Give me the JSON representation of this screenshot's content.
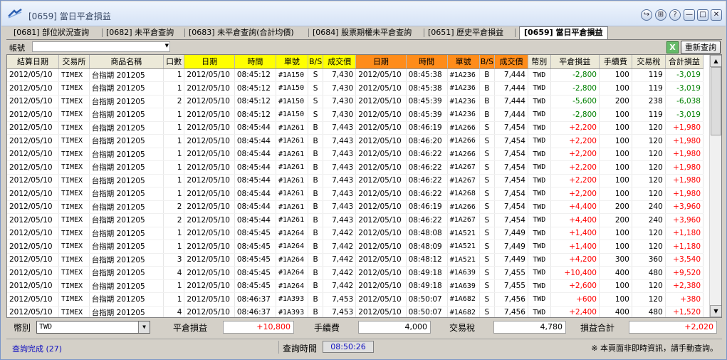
{
  "window": {
    "title": "[0659] 當日平倉損益",
    "buttons": [
      "↪",
      "⊞",
      "?",
      "—",
      "□",
      "✕"
    ]
  },
  "tabs": [
    {
      "label": "[0681] 部位狀況查詢",
      "active": false
    },
    {
      "label": "[0682] 未平倉查詢",
      "active": false
    },
    {
      "label": "[0683] 未平倉查詢(合計均價)",
      "active": false
    },
    {
      "label": "[0684] 股票期權未平倉查詢",
      "active": false
    },
    {
      "label": "[0651] 歷史平倉損益",
      "active": false
    },
    {
      "label": "[0659] 當日平倉損益",
      "active": true
    }
  ],
  "account": {
    "label": "帳號",
    "value": ""
  },
  "toolbar": {
    "excel_label": "X",
    "requery_label": "重新查詢"
  },
  "colors": {
    "yellow_header": "#ffff00",
    "orange_header": "#ff8c1a",
    "positive": "#ff0000",
    "negative": "#008000",
    "status_blue": "#1010c0"
  },
  "columns": [
    "結算日期",
    "交易所",
    "商品名稱",
    "口數",
    "日期",
    "時間",
    "單號",
    "B/S",
    "成交價",
    "日期",
    "時間",
    "單號",
    "B/S",
    "成交價",
    "幣別",
    "平倉損益",
    "手續費",
    "交易稅",
    "合計損益"
  ],
  "rows": [
    [
      "2012/05/10",
      "TIMEX",
      "台指期 201205",
      "1",
      "2012/05/10",
      "08:45:12",
      "#1A150",
      "S",
      "7,430",
      "2012/05/10",
      "08:45:38",
      "#1A236",
      "B",
      "7,444",
      "TWD",
      "-2,800",
      "100",
      "119",
      "-3,019"
    ],
    [
      "2012/05/10",
      "TIMEX",
      "台指期 201205",
      "1",
      "2012/05/10",
      "08:45:12",
      "#1A150",
      "S",
      "7,430",
      "2012/05/10",
      "08:45:38",
      "#1A236",
      "B",
      "7,444",
      "TWD",
      "-2,800",
      "100",
      "119",
      "-3,019"
    ],
    [
      "2012/05/10",
      "TIMEX",
      "台指期 201205",
      "2",
      "2012/05/10",
      "08:45:12",
      "#1A150",
      "S",
      "7,430",
      "2012/05/10",
      "08:45:39",
      "#1A236",
      "B",
      "7,444",
      "TWD",
      "-5,600",
      "200",
      "238",
      "-6,038"
    ],
    [
      "2012/05/10",
      "TIMEX",
      "台指期 201205",
      "1",
      "2012/05/10",
      "08:45:12",
      "#1A150",
      "S",
      "7,430",
      "2012/05/10",
      "08:45:39",
      "#1A236",
      "B",
      "7,444",
      "TWD",
      "-2,800",
      "100",
      "119",
      "-3,019"
    ],
    [
      "2012/05/10",
      "TIMEX",
      "台指期 201205",
      "1",
      "2012/05/10",
      "08:45:44",
      "#1A261",
      "B",
      "7,443",
      "2012/05/10",
      "08:46:19",
      "#1A266",
      "S",
      "7,454",
      "TWD",
      "+2,200",
      "100",
      "120",
      "+1,980"
    ],
    [
      "2012/05/10",
      "TIMEX",
      "台指期 201205",
      "1",
      "2012/05/10",
      "08:45:44",
      "#1A261",
      "B",
      "7,443",
      "2012/05/10",
      "08:46:20",
      "#1A266",
      "S",
      "7,454",
      "TWD",
      "+2,200",
      "100",
      "120",
      "+1,980"
    ],
    [
      "2012/05/10",
      "TIMEX",
      "台指期 201205",
      "1",
      "2012/05/10",
      "08:45:44",
      "#1A261",
      "B",
      "7,443",
      "2012/05/10",
      "08:46:22",
      "#1A266",
      "S",
      "7,454",
      "TWD",
      "+2,200",
      "100",
      "120",
      "+1,980"
    ],
    [
      "2012/05/10",
      "TIMEX",
      "台指期 201205",
      "1",
      "2012/05/10",
      "08:45:44",
      "#1A261",
      "B",
      "7,443",
      "2012/05/10",
      "08:46:22",
      "#1A267",
      "S",
      "7,454",
      "TWD",
      "+2,200",
      "100",
      "120",
      "+1,980"
    ],
    [
      "2012/05/10",
      "TIMEX",
      "台指期 201205",
      "1",
      "2012/05/10",
      "08:45:44",
      "#1A261",
      "B",
      "7,443",
      "2012/05/10",
      "08:46:22",
      "#1A267",
      "S",
      "7,454",
      "TWD",
      "+2,200",
      "100",
      "120",
      "+1,980"
    ],
    [
      "2012/05/10",
      "TIMEX",
      "台指期 201205",
      "1",
      "2012/05/10",
      "08:45:44",
      "#1A261",
      "B",
      "7,443",
      "2012/05/10",
      "08:46:22",
      "#1A268",
      "S",
      "7,454",
      "TWD",
      "+2,200",
      "100",
      "120",
      "+1,980"
    ],
    [
      "2012/05/10",
      "TIMEX",
      "台指期 201205",
      "2",
      "2012/05/10",
      "08:45:44",
      "#1A261",
      "B",
      "7,443",
      "2012/05/10",
      "08:46:19",
      "#1A266",
      "S",
      "7,454",
      "TWD",
      "+4,400",
      "200",
      "240",
      "+3,960"
    ],
    [
      "2012/05/10",
      "TIMEX",
      "台指期 201205",
      "2",
      "2012/05/10",
      "08:45:44",
      "#1A261",
      "B",
      "7,443",
      "2012/05/10",
      "08:46:22",
      "#1A267",
      "S",
      "7,454",
      "TWD",
      "+4,400",
      "200",
      "240",
      "+3,960"
    ],
    [
      "2012/05/10",
      "TIMEX",
      "台指期 201205",
      "1",
      "2012/05/10",
      "08:45:45",
      "#1A264",
      "B",
      "7,442",
      "2012/05/10",
      "08:48:08",
      "#1A521",
      "S",
      "7,449",
      "TWD",
      "+1,400",
      "100",
      "120",
      "+1,180"
    ],
    [
      "2012/05/10",
      "TIMEX",
      "台指期 201205",
      "1",
      "2012/05/10",
      "08:45:45",
      "#1A264",
      "B",
      "7,442",
      "2012/05/10",
      "08:48:09",
      "#1A521",
      "S",
      "7,449",
      "TWD",
      "+1,400",
      "100",
      "120",
      "+1,180"
    ],
    [
      "2012/05/10",
      "TIMEX",
      "台指期 201205",
      "3",
      "2012/05/10",
      "08:45:45",
      "#1A264",
      "B",
      "7,442",
      "2012/05/10",
      "08:48:12",
      "#1A521",
      "S",
      "7,449",
      "TWD",
      "+4,200",
      "300",
      "360",
      "+3,540"
    ],
    [
      "2012/05/10",
      "TIMEX",
      "台指期 201205",
      "4",
      "2012/05/10",
      "08:45:45",
      "#1A264",
      "B",
      "7,442",
      "2012/05/10",
      "08:49:18",
      "#1A639",
      "S",
      "7,455",
      "TWD",
      "+10,400",
      "400",
      "480",
      "+9,520"
    ],
    [
      "2012/05/10",
      "TIMEX",
      "台指期 201205",
      "1",
      "2012/05/10",
      "08:45:45",
      "#1A264",
      "B",
      "7,442",
      "2012/05/10",
      "08:49:18",
      "#1A639",
      "S",
      "7,455",
      "TWD",
      "+2,600",
      "100",
      "120",
      "+2,380"
    ],
    [
      "2012/05/10",
      "TIMEX",
      "台指期 201205",
      "1",
      "2012/05/10",
      "08:46:37",
      "#1A393",
      "B",
      "7,453",
      "2012/05/10",
      "08:50:07",
      "#1A682",
      "S",
      "7,456",
      "TWD",
      "+600",
      "100",
      "120",
      "+380"
    ],
    [
      "2012/05/10",
      "TIMEX",
      "台指期 201205",
      "4",
      "2012/05/10",
      "08:46:37",
      "#1A393",
      "B",
      "7,453",
      "2012/05/10",
      "08:50:07",
      "#1A682",
      "S",
      "7,456",
      "TWD",
      "+2,400",
      "400",
      "480",
      "+1,520"
    ]
  ],
  "summary": {
    "currency_label": "幣別",
    "currency_value": "TWD",
    "pnl_label": "平倉損益",
    "pnl_value": "+10,800",
    "fee_label": "手續費",
    "fee_value": "4,000",
    "tax_label": "交易稅",
    "tax_value": "4,780",
    "total_label": "損益合計",
    "total_value": "+2,020"
  },
  "status": {
    "text": "查詢完成 (27)",
    "query_time_label": "查詢時間",
    "query_time": "08:50:26",
    "notice": "※ 本頁面非即時資訊，請手動查詢。"
  }
}
